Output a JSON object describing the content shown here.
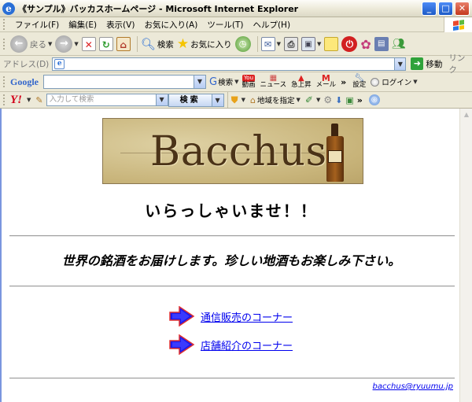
{
  "window": {
    "title": "《サンプル》バッカスホームページ - Microsoft Internet Explorer",
    "minimize": "_",
    "maximize": "□",
    "close": "✕"
  },
  "menu": {
    "items": [
      "ファイル(F)",
      "編集(E)",
      "表示(V)",
      "お気に入り(A)",
      "ツール(T)",
      "ヘルプ(H)"
    ]
  },
  "toolbar": {
    "back_label": "戻る",
    "search_label": "検索",
    "favorites_label": "お気に入り"
  },
  "address": {
    "label": "アドレス(D)",
    "value": "",
    "go_label": "移動",
    "links_label": "リンク"
  },
  "google_toolbar": {
    "logo": "Google",
    "search_label": "検索",
    "video_label": "動画",
    "news_label": "ニュース",
    "rising_label": "急上昇",
    "mail_label": "メール",
    "settings_label": "設定",
    "login_label": "ログイン"
  },
  "yahoo_toolbar": {
    "logo": "Y!",
    "input_placeholder": "入力して検索",
    "search_button": "検索",
    "region_label": "地域を指定"
  },
  "page": {
    "banner_text": "Bacchus",
    "welcome": "いらっしゃいませ！！",
    "tagline": "世界の銘酒をお届けします。珍しい地酒もお楽しみ下さい。",
    "links": [
      {
        "label": "通信販売のコーナー"
      },
      {
        "label": "店舗紹介のコーナー"
      }
    ],
    "email": "bacchus@ryuumu.jp"
  },
  "colors": {
    "link": "#0000ee",
    "titlebar_text": "#000000",
    "banner_bg": "#c8b47a",
    "arrow_fill": "#1a1aee",
    "arrow_outline": "#e03030"
  }
}
